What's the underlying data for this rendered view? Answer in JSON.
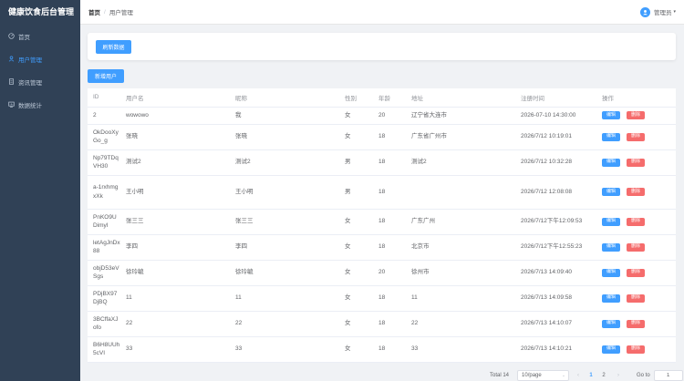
{
  "app": {
    "title": "健康饮食后台管理"
  },
  "sidebar": {
    "items": [
      {
        "label": "首页",
        "icon": "dashboard-icon"
      },
      {
        "label": "用户管理",
        "icon": "user-icon",
        "active": true
      },
      {
        "label": "资讯管理",
        "icon": "document-icon"
      },
      {
        "label": "数据统计",
        "icon": "chart-icon"
      }
    ]
  },
  "header": {
    "breadcrumb_home": "首页",
    "breadcrumb_sep": "/",
    "breadcrumb_current": "用户管理",
    "user_name": "管理员",
    "caret": "▾"
  },
  "actions": {
    "refresh_label": "刷新数据",
    "add_label": "新增用户"
  },
  "table": {
    "columns": [
      "ID",
      "用户名",
      "昵称",
      "性别",
      "年龄",
      "地址",
      "注册时间",
      "操作"
    ],
    "edit_label": "编辑",
    "delete_label": "删除",
    "rows": [
      {
        "id": "2",
        "username": "wowowo",
        "nickname": "我",
        "gender": "女",
        "age": "20",
        "address": "辽宁省大连市",
        "time": "2026-07-10 14:30:00"
      },
      {
        "id": "OkDooXyGo_g",
        "username": "张晓",
        "nickname": "张晓",
        "gender": "女",
        "age": "18",
        "address": "广东省广州市",
        "time": "2026/7/12 10:19:01"
      },
      {
        "id": "Np79TDqVH30",
        "username": "测试2",
        "nickname": "测试2",
        "gender": "男",
        "age": "18",
        "address": "测试2",
        "time": "2026/7/12 10:32:28"
      },
      {
        "id": "a-1rxhmgxXk",
        "username": "王小明",
        "nickname": "王小明",
        "gender": "男",
        "age": "18",
        "address": "",
        "time": "2026/7/12 12:08:08"
      },
      {
        "id": "PnKO9UDimyI",
        "username": "张三三",
        "nickname": "张三三",
        "gender": "女",
        "age": "18",
        "address": "广东广州",
        "time": "2026/7/12下午12:09:53"
      },
      {
        "id": "letAgJnDx88",
        "username": "李四",
        "nickname": "李四",
        "gender": "女",
        "age": "18",
        "address": "北京市",
        "time": "2026/7/12下午12:55:23"
      },
      {
        "id": "objD53eVSgs",
        "username": "徐玲毓",
        "nickname": "徐玲毓",
        "gender": "女",
        "age": "20",
        "address": "徐州市",
        "time": "2026/7/13 14:09:40"
      },
      {
        "id": "PDjBX97DjBQ",
        "username": "11",
        "nickname": "11",
        "gender": "女",
        "age": "18",
        "address": "11",
        "time": "2026/7/13 14:09:58"
      },
      {
        "id": "3BCffaXJofo",
        "username": "22",
        "nickname": "22",
        "gender": "女",
        "age": "18",
        "address": "22",
        "time": "2026/7/13 14:10:07"
      },
      {
        "id": "B6H8UUh5cVI",
        "username": "33",
        "nickname": "33",
        "gender": "女",
        "age": "18",
        "address": "33",
        "time": "2026/7/13 14:10:21"
      }
    ]
  },
  "pagination": {
    "total_text": "Total 14",
    "page_size": "10/page",
    "pages": [
      "1",
      "2"
    ],
    "current_page": "1",
    "goto_label": "Go to",
    "goto_value": "1",
    "prev": "‹",
    "next": "›",
    "size_caret": "⌄"
  },
  "colors": {
    "sidebar": "#304156",
    "accent": "#409eff",
    "danger": "#f56c6c"
  }
}
